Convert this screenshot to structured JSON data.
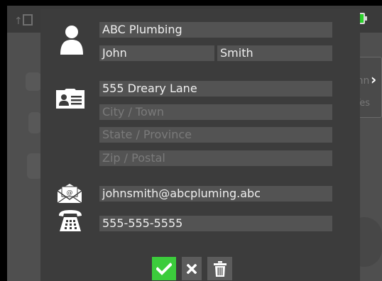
{
  "contact": {
    "company": "ABC Plumbing",
    "first_name": "John",
    "last_name": "Smith",
    "address": "555 Dreary Lane",
    "city_placeholder": "City / Town",
    "state_placeholder": "State / Province",
    "zip_placeholder": "Zip / Postal",
    "email": "johnsmith@abcpluming.abc",
    "phone": "555-555-5555"
  },
  "background": {
    "panel_name": "ohn",
    "panel_value": "Yes"
  },
  "icons": {
    "person": "person-icon",
    "address": "address-card-icon",
    "email": "envelope-icon",
    "phone": "telephone-icon",
    "save": "checkmark-icon",
    "cancel": "close-icon",
    "delete": "trash-icon",
    "battery": "battery-icon"
  },
  "colors": {
    "confirm": "#3ccc3c",
    "battery": "#2bd12b",
    "modal_bg": "#3c3c3c",
    "field_bg": "#535353"
  }
}
